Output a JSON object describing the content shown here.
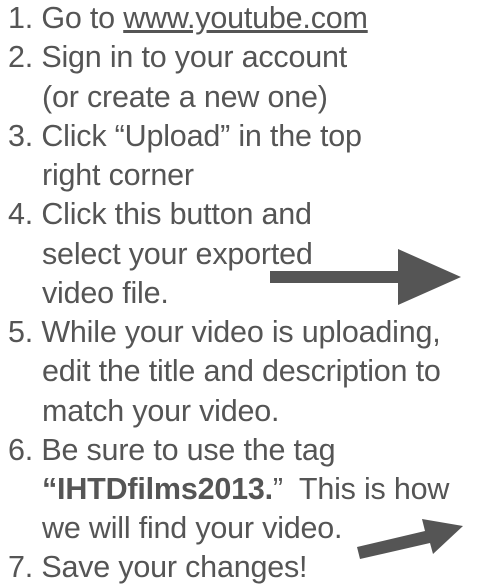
{
  "steps": [
    {
      "number": "1.",
      "text_before": "Go to",
      "link": "www.youtube.com"
    },
    {
      "number": "2.",
      "line1": "Sign in to your account",
      "line2": "(or create a new one)"
    },
    {
      "number": "3.",
      "line1": "Click “Upload” in the top",
      "line2": "right corner"
    },
    {
      "number": "4.",
      "line1": "Click this button and",
      "line2": "select your exported",
      "line3": "video file."
    },
    {
      "number": "5.",
      "line1": "While your video is uploading,",
      "line2": "edit the title and description to",
      "line3": "match your video."
    },
    {
      "number": "6.",
      "line1": "Be sure to use the tag",
      "tag": "“IHTDfilms2013.",
      "closing_quote": "”",
      "line2_rest": "This is how",
      "line3": "we will find your video."
    },
    {
      "number": "7.",
      "line1": "Save your changes!"
    }
  ],
  "colors": {
    "text": "#555555",
    "arrow": "#555555"
  }
}
